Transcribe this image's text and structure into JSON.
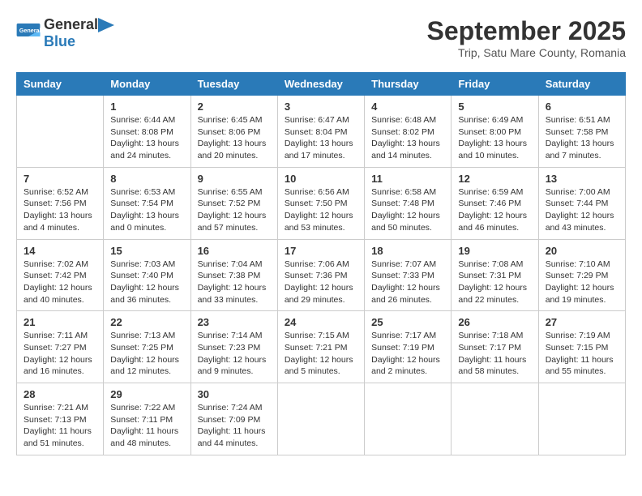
{
  "header": {
    "logo_general": "General",
    "logo_blue": "Blue",
    "month_title": "September 2025",
    "subtitle": "Trip, Satu Mare County, Romania"
  },
  "days_of_week": [
    "Sunday",
    "Monday",
    "Tuesday",
    "Wednesday",
    "Thursday",
    "Friday",
    "Saturday"
  ],
  "weeks": [
    [
      {
        "day": "",
        "info": ""
      },
      {
        "day": "1",
        "info": "Sunrise: 6:44 AM\nSunset: 8:08 PM\nDaylight: 13 hours\nand 24 minutes."
      },
      {
        "day": "2",
        "info": "Sunrise: 6:45 AM\nSunset: 8:06 PM\nDaylight: 13 hours\nand 20 minutes."
      },
      {
        "day": "3",
        "info": "Sunrise: 6:47 AM\nSunset: 8:04 PM\nDaylight: 13 hours\nand 17 minutes."
      },
      {
        "day": "4",
        "info": "Sunrise: 6:48 AM\nSunset: 8:02 PM\nDaylight: 13 hours\nand 14 minutes."
      },
      {
        "day": "5",
        "info": "Sunrise: 6:49 AM\nSunset: 8:00 PM\nDaylight: 13 hours\nand 10 minutes."
      },
      {
        "day": "6",
        "info": "Sunrise: 6:51 AM\nSunset: 7:58 PM\nDaylight: 13 hours\nand 7 minutes."
      }
    ],
    [
      {
        "day": "7",
        "info": "Sunrise: 6:52 AM\nSunset: 7:56 PM\nDaylight: 13 hours\nand 4 minutes."
      },
      {
        "day": "8",
        "info": "Sunrise: 6:53 AM\nSunset: 7:54 PM\nDaylight: 13 hours\nand 0 minutes."
      },
      {
        "day": "9",
        "info": "Sunrise: 6:55 AM\nSunset: 7:52 PM\nDaylight: 12 hours\nand 57 minutes."
      },
      {
        "day": "10",
        "info": "Sunrise: 6:56 AM\nSunset: 7:50 PM\nDaylight: 12 hours\nand 53 minutes."
      },
      {
        "day": "11",
        "info": "Sunrise: 6:58 AM\nSunset: 7:48 PM\nDaylight: 12 hours\nand 50 minutes."
      },
      {
        "day": "12",
        "info": "Sunrise: 6:59 AM\nSunset: 7:46 PM\nDaylight: 12 hours\nand 46 minutes."
      },
      {
        "day": "13",
        "info": "Sunrise: 7:00 AM\nSunset: 7:44 PM\nDaylight: 12 hours\nand 43 minutes."
      }
    ],
    [
      {
        "day": "14",
        "info": "Sunrise: 7:02 AM\nSunset: 7:42 PM\nDaylight: 12 hours\nand 40 minutes."
      },
      {
        "day": "15",
        "info": "Sunrise: 7:03 AM\nSunset: 7:40 PM\nDaylight: 12 hours\nand 36 minutes."
      },
      {
        "day": "16",
        "info": "Sunrise: 7:04 AM\nSunset: 7:38 PM\nDaylight: 12 hours\nand 33 minutes."
      },
      {
        "day": "17",
        "info": "Sunrise: 7:06 AM\nSunset: 7:36 PM\nDaylight: 12 hours\nand 29 minutes."
      },
      {
        "day": "18",
        "info": "Sunrise: 7:07 AM\nSunset: 7:33 PM\nDaylight: 12 hours\nand 26 minutes."
      },
      {
        "day": "19",
        "info": "Sunrise: 7:08 AM\nSunset: 7:31 PM\nDaylight: 12 hours\nand 22 minutes."
      },
      {
        "day": "20",
        "info": "Sunrise: 7:10 AM\nSunset: 7:29 PM\nDaylight: 12 hours\nand 19 minutes."
      }
    ],
    [
      {
        "day": "21",
        "info": "Sunrise: 7:11 AM\nSunset: 7:27 PM\nDaylight: 12 hours\nand 16 minutes."
      },
      {
        "day": "22",
        "info": "Sunrise: 7:13 AM\nSunset: 7:25 PM\nDaylight: 12 hours\nand 12 minutes."
      },
      {
        "day": "23",
        "info": "Sunrise: 7:14 AM\nSunset: 7:23 PM\nDaylight: 12 hours\nand 9 minutes."
      },
      {
        "day": "24",
        "info": "Sunrise: 7:15 AM\nSunset: 7:21 PM\nDaylight: 12 hours\nand 5 minutes."
      },
      {
        "day": "25",
        "info": "Sunrise: 7:17 AM\nSunset: 7:19 PM\nDaylight: 12 hours\nand 2 minutes."
      },
      {
        "day": "26",
        "info": "Sunrise: 7:18 AM\nSunset: 7:17 PM\nDaylight: 11 hours\nand 58 minutes."
      },
      {
        "day": "27",
        "info": "Sunrise: 7:19 AM\nSunset: 7:15 PM\nDaylight: 11 hours\nand 55 minutes."
      }
    ],
    [
      {
        "day": "28",
        "info": "Sunrise: 7:21 AM\nSunset: 7:13 PM\nDaylight: 11 hours\nand 51 minutes."
      },
      {
        "day": "29",
        "info": "Sunrise: 7:22 AM\nSunset: 7:11 PM\nDaylight: 11 hours\nand 48 minutes."
      },
      {
        "day": "30",
        "info": "Sunrise: 7:24 AM\nSunset: 7:09 PM\nDaylight: 11 hours\nand 44 minutes."
      },
      {
        "day": "",
        "info": ""
      },
      {
        "day": "",
        "info": ""
      },
      {
        "day": "",
        "info": ""
      },
      {
        "day": "",
        "info": ""
      }
    ]
  ]
}
